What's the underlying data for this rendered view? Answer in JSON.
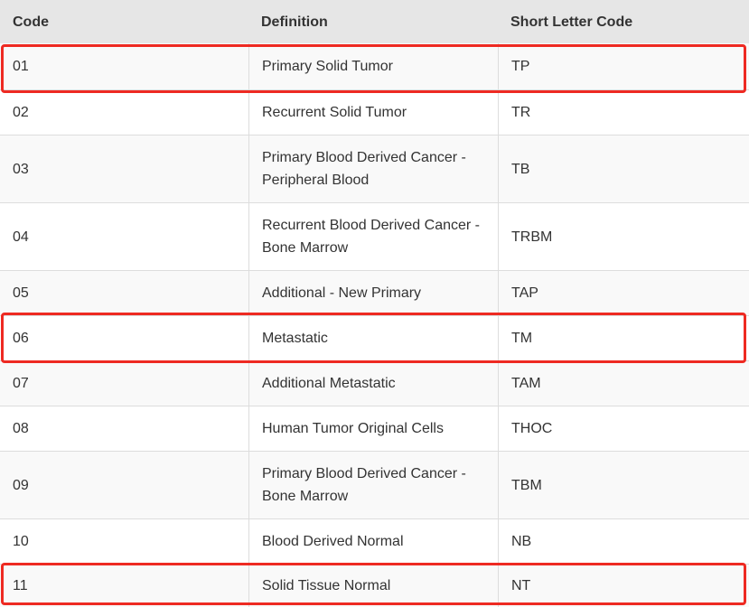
{
  "table": {
    "headers": [
      "Code",
      "Definition",
      "Short Letter Code"
    ],
    "rows": [
      {
        "code": "01",
        "definition": "Primary Solid Tumor",
        "short": "TP"
      },
      {
        "code": "02",
        "definition": "Recurrent Solid Tumor",
        "short": "TR"
      },
      {
        "code": "03",
        "definition": "Primary Blood Derived Cancer - Peripheral Blood",
        "short": "TB"
      },
      {
        "code": "04",
        "definition": "Recurrent Blood Derived Cancer - Bone Marrow",
        "short": "TRBM"
      },
      {
        "code": "05",
        "definition": "Additional - New Primary",
        "short": "TAP"
      },
      {
        "code": "06",
        "definition": "Metastatic",
        "short": "TM"
      },
      {
        "code": "07",
        "definition": "Additional Metastatic",
        "short": "TAM"
      },
      {
        "code": "08",
        "definition": "Human Tumor Original Cells",
        "short": "THOC"
      },
      {
        "code": "09",
        "definition": "Primary Blood Derived Cancer - Bone Marrow",
        "short": "TBM"
      },
      {
        "code": "10",
        "definition": "Blood Derived Normal",
        "short": "NB"
      },
      {
        "code": "11",
        "definition": "Solid Tissue Normal",
        "short": "NT"
      }
    ]
  },
  "highlight_color": "#ee2a22",
  "highlighted_codes": [
    "01",
    "06",
    "11"
  ]
}
